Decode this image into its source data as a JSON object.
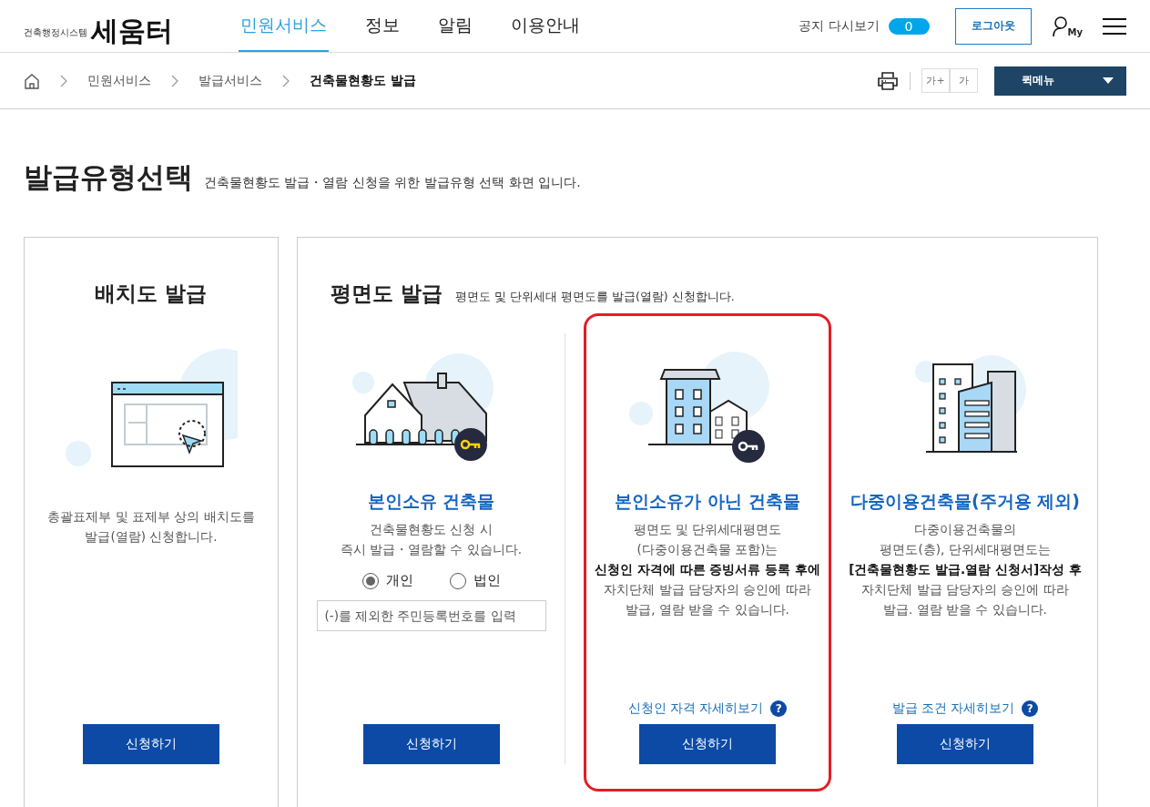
{
  "header": {
    "logo": {
      "name": "세움터",
      "tagline": "건축행정시스템"
    },
    "nav": [
      {
        "label": "민원서비스",
        "selected": true
      },
      {
        "label": "정보",
        "selected": false
      },
      {
        "label": "알림",
        "selected": false
      },
      {
        "label": "이용안내",
        "selected": false
      }
    ],
    "notice": {
      "label": "공지 다시보기",
      "count": "0"
    },
    "logout": "로그아웃",
    "my_label": "My"
  },
  "breadcrumb": [
    "민원서비스",
    "발급서비스",
    "건축물현황도 발급"
  ],
  "tools": {
    "font_up": "가+",
    "font_down": "가",
    "quick_menu": "퀵메뉴"
  },
  "page": {
    "title": "발급유형선택",
    "subtitle": "건축물현황도 발급・열람 신청을 위한 발급유형 선택 화면 입니다."
  },
  "site_plan": {
    "title": "배치도 발급",
    "description": "총괄표제부 및 표제부 상의 배치도를\n발급(열람) 신청합니다.",
    "button": "신청하기"
  },
  "floor_plan": {
    "title": "평면도 발급",
    "subtitle": "평면도 및 단위세대 평면도를 발급(열람) 신청합니다.",
    "options": [
      {
        "kind": "own",
        "highlighted": false,
        "title": "본인소유 건축물",
        "description": "건축물현황도 신청 시\n즉시 발급・열람할 수 있습니다.",
        "radios": [
          {
            "label": "개인",
            "selected": true
          },
          {
            "label": "법인",
            "selected": false
          }
        ],
        "placeholder": "(-)를 제외한 주민등록번호를 입력",
        "button": "신청하기"
      },
      {
        "kind": "not_own",
        "highlighted": true,
        "title": "본인소유가 아닌 건축물",
        "description": "평면도 및 단위세대평면도\n(다중이용건축물 포함)는\n**신청인 자격에 따른 증빙서류 등록 후에**\n자치단체 발급 담당자의 승인에 따라\n발급, 열람 받을 수 있습니다.",
        "help_link": "신청인 자격 자세히보기",
        "help_icon": "?",
        "button": "신청하기"
      },
      {
        "kind": "multi_use",
        "highlighted": false,
        "title": "다중이용건축물(주거용 제외)",
        "description": "다중이용건축물의\n평면도(층), 단위세대평면도는\n**[건축물현황도 발급.열람 신청서]작성 후**\n자치단체 발급 담당자의 승인에 따라\n발급. 열람 받을 수 있습니다.",
        "help_link": "발급 조건 자세히보기",
        "help_icon": "?",
        "button": "신청하기"
      }
    ]
  }
}
